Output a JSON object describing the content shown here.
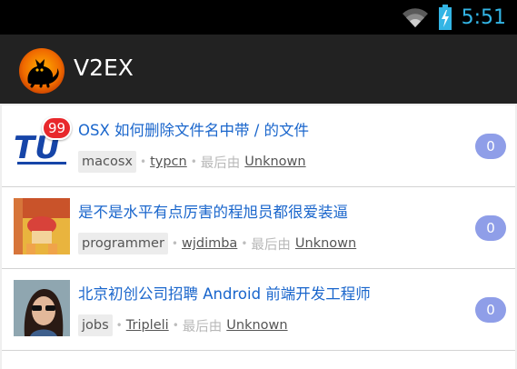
{
  "status_bar": {
    "time": "5:51"
  },
  "action_bar": {
    "title": "V2EX"
  },
  "topics": [
    {
      "title": "OSX 如何删除文件名中带 / 的文件",
      "node": "macosx",
      "member": "typcn",
      "replied_by_label": "最后由",
      "last_replier": "Unknown",
      "replies": "0",
      "badge": "99"
    },
    {
      "title": "是不是水平有点厉害的程旭员都很爱装逼",
      "node": "programmer",
      "member": "wjdimba",
      "replied_by_label": "最后由",
      "last_replier": "Unknown",
      "replies": "0"
    },
    {
      "title": "北京初创公司招聘 Android 前端开发工程师",
      "node": "jobs",
      "member": "Tripleli",
      "replied_by_label": "最后由",
      "last_replier": "Unknown",
      "replies": "0"
    }
  ],
  "colors": {
    "title": "#1a66cc",
    "count_badge": "#8f9ee8",
    "action_bar": "#222222",
    "status_time": "#33b5e5"
  }
}
